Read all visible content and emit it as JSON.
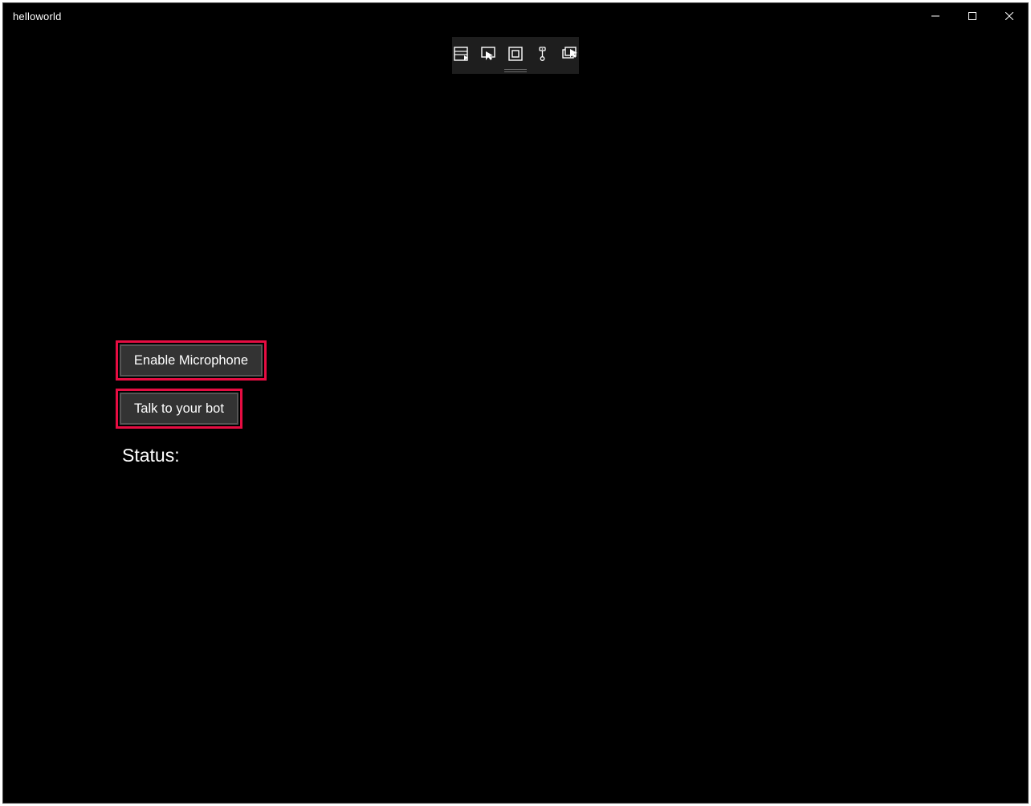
{
  "window": {
    "title": "helloworld"
  },
  "toolbar": {
    "icons": [
      "live-visual-tree-icon",
      "select-element-icon",
      "display-layout-adorners-icon",
      "track-focused-element-icon",
      "go-to-live-visual-tree-icon"
    ]
  },
  "main": {
    "enable_microphone_label": "Enable Microphone",
    "talk_to_bot_label": "Talk to your bot",
    "status_label": "Status:"
  },
  "highlight_color": "#e60d42"
}
